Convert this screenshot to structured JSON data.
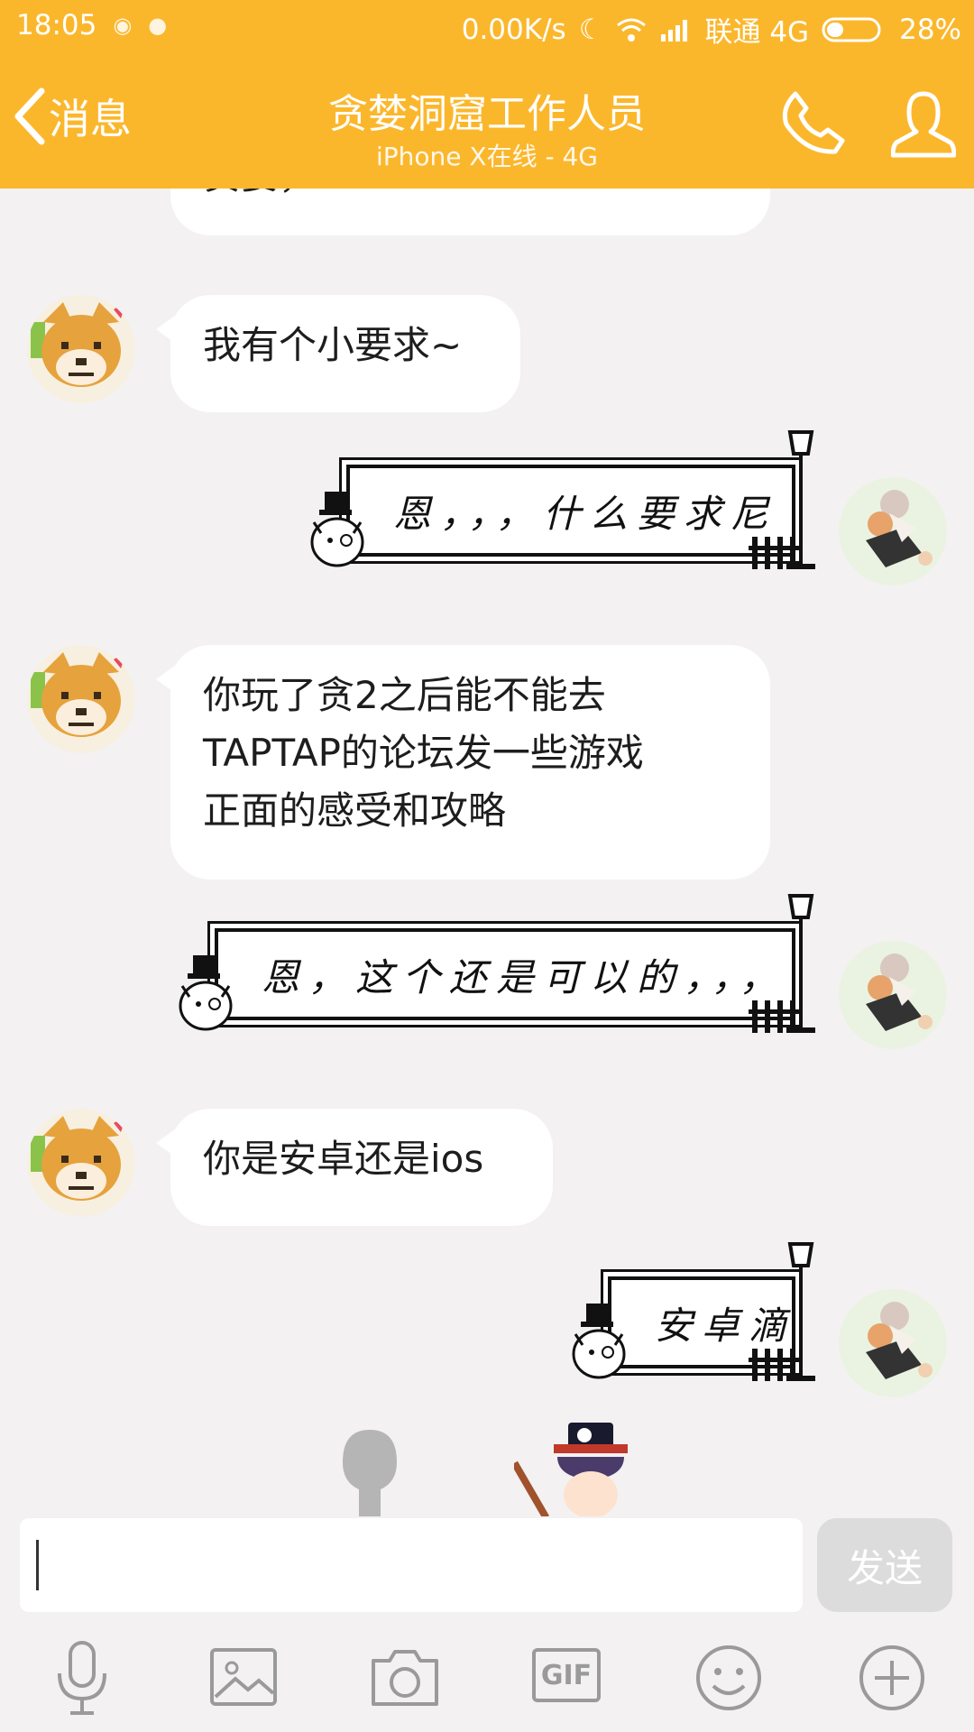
{
  "status": {
    "time": "18:05",
    "speed": "0.00K/s",
    "carrier": "联通 4G",
    "battery": "28%"
  },
  "header": {
    "back_label": "消息",
    "title": "贪婪洞窟工作人员",
    "subtitle": "iPhone X在线 - 4G"
  },
  "messages": [
    {
      "side": "left",
      "text": "贪婪，"
    },
    {
      "side": "left",
      "text": "我有个小要求~"
    },
    {
      "side": "right",
      "text": "恩，，，什么要求尼"
    },
    {
      "side": "left",
      "lines": [
        "你玩了贪2之后能不能去",
        "TAPTAP的论坛发一些游戏",
        "正面的感受和攻略"
      ]
    },
    {
      "side": "right",
      "text": "恩，这个还是可以的，，，"
    },
    {
      "side": "left",
      "text": "你是安卓还是ios"
    },
    {
      "side": "right",
      "text": "安卓滴"
    }
  ],
  "input": {
    "placeholder": "",
    "send_label": "发送"
  },
  "toolbar": {
    "gif_label": "GIF"
  },
  "colors": {
    "accent": "#fbb72c",
    "bubble": "#ffffff",
    "background": "#f3f1f2"
  }
}
